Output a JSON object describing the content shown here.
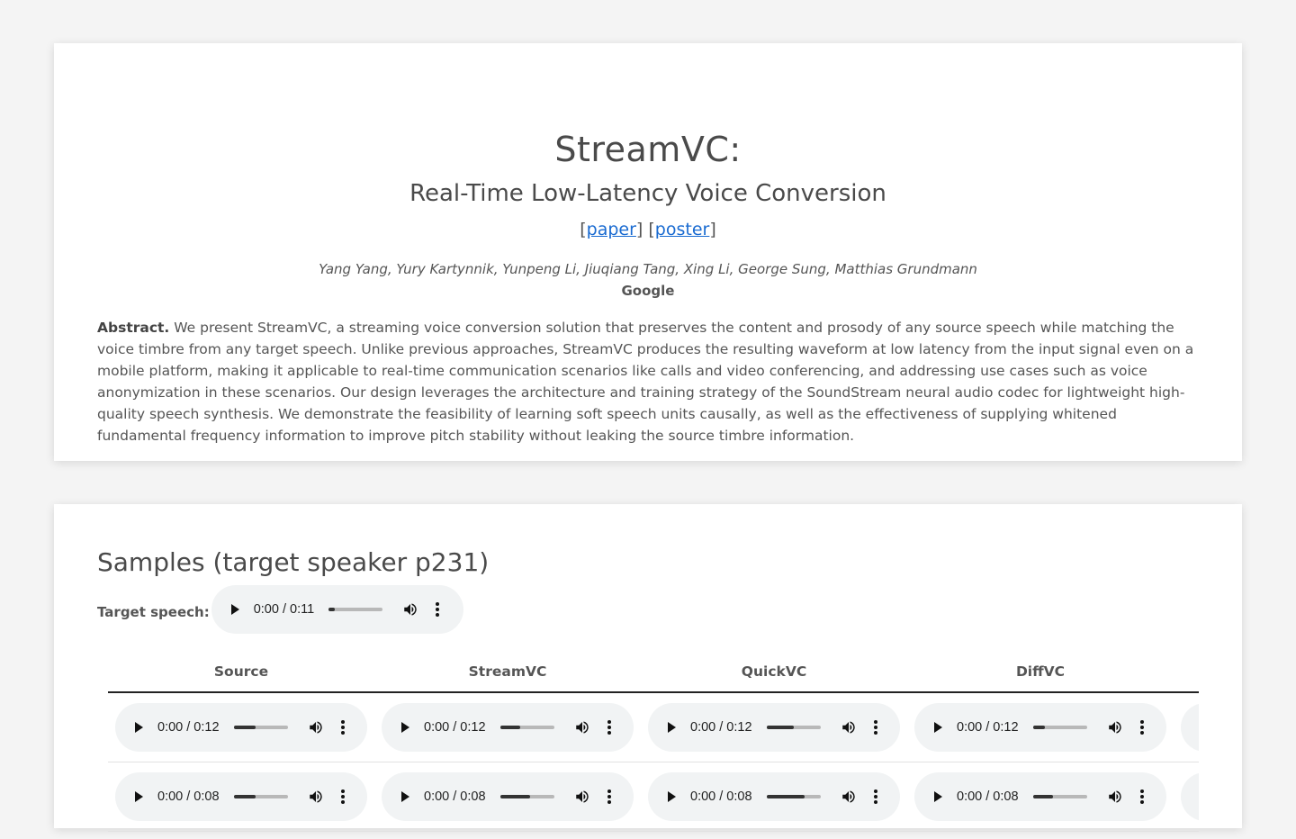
{
  "header": {
    "title": "StreamVC:",
    "subtitle": "Real-Time Low-Latency Voice Conversion",
    "link_open": "[",
    "link_sep": "] [",
    "link_close": "]",
    "paper_label": "paper",
    "poster_label": "poster",
    "authors": "Yang Yang, Yury Kartynnik, Yunpeng Li, Jiuqiang Tang, Xing Li, George Sung, Matthias Grundmann",
    "affiliation": "Google",
    "abstract_label": "Abstract.",
    "abstract_text": " We present StreamVC, a streaming voice conversion solution that preserves the content and prosody of any source speech while matching the voice timbre from any target speech. Unlike previous approaches, StreamVC produces the resulting waveform at low latency from the input signal even on a mobile platform, making it applicable to real-time communication scenarios like calls and video conferencing, and addressing use cases such as voice anonymization in these scenarios. Our design leverages the architecture and training strategy of the SoundStream neural audio codec for lightweight high-quality speech synthesis. We demonstrate the feasibility of learning soft speech units causally, as well as the effectiveness of supplying whitened fundamental frequency information to improve pitch stability without leaking the source timbre information."
  },
  "samples": {
    "title": "Samples (target speaker p231)",
    "target_label": "Target speech:",
    "target_player": {
      "time": "0:00 / 0:11",
      "progress": 0.12
    },
    "columns": [
      "Source",
      "StreamVC",
      "QuickVC",
      "DiffVC"
    ],
    "rows": [
      [
        {
          "time": "0:00 / 0:12",
          "progress": 0.4
        },
        {
          "time": "0:00 / 0:12",
          "progress": 0.38
        },
        {
          "time": "0:00 / 0:12",
          "progress": 0.5
        },
        {
          "time": "0:00 / 0:12",
          "progress": 0.22
        }
      ],
      [
        {
          "time": "0:00 / 0:08",
          "progress": 0.4
        },
        {
          "time": "0:00 / 0:08",
          "progress": 0.55
        },
        {
          "time": "0:00 / 0:08",
          "progress": 0.7
        },
        {
          "time": "0:00 / 0:08",
          "progress": 0.38
        }
      ]
    ]
  },
  "colors": {
    "link": "#1a6bd1",
    "text": "#555555",
    "player_bg": "#f1f3f4"
  },
  "icons": {
    "play": "play-icon",
    "volume": "volume-icon",
    "more": "more-vert-icon"
  }
}
